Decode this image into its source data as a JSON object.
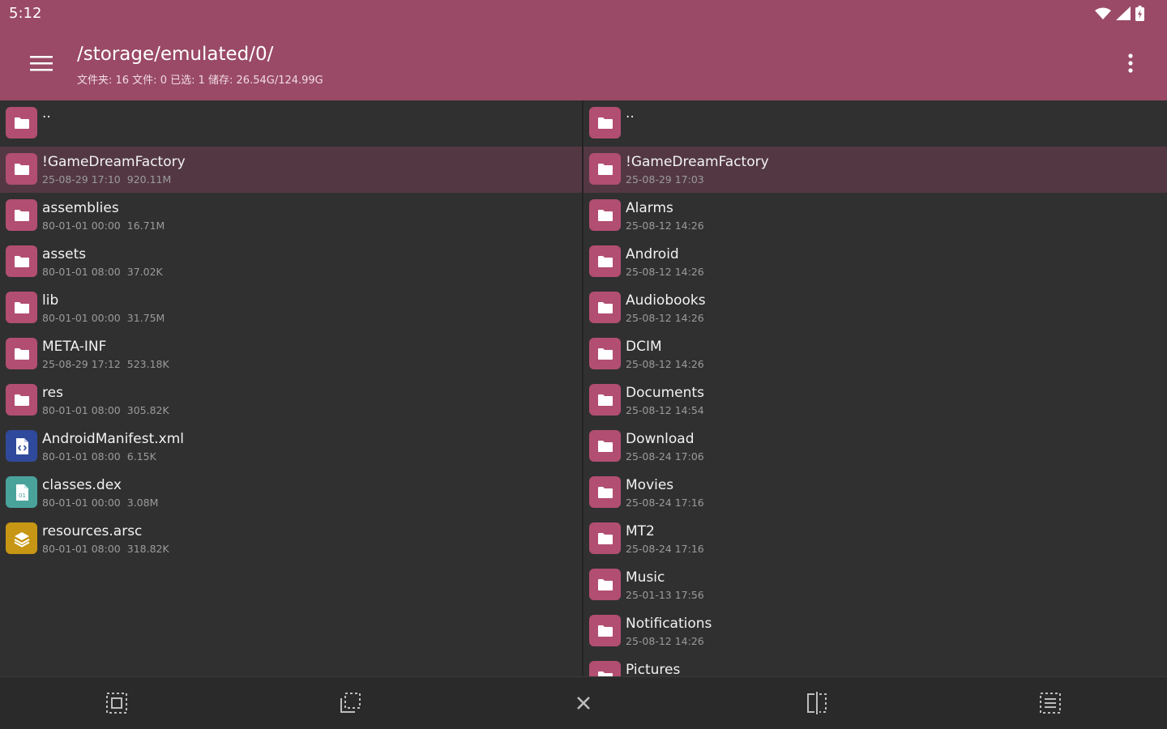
{
  "status": {
    "time": "5:12"
  },
  "toolbar": {
    "path": "/storage/emulated/0/",
    "info": "文件夹: 16  文件: 0  已选: 1  储存: 26.54G/124.99G"
  },
  "colors": {
    "accent": "#9a4a66",
    "folder": "#b24e72",
    "xml": "#2f4a9c",
    "dex": "#4aa39b",
    "arsc": "#c79614"
  },
  "left_panel": [
    {
      "name": "..",
      "date": "",
      "size": "",
      "icon": "folder-icon",
      "selected": false
    },
    {
      "name": "!GameDreamFactory",
      "date": "25-08-29 17:10",
      "size": "920.11M",
      "icon": "folder-icon",
      "selected": true
    },
    {
      "name": "assemblies",
      "date": "80-01-01 00:00",
      "size": "16.71M",
      "icon": "folder-icon",
      "selected": false
    },
    {
      "name": "assets",
      "date": "80-01-01 08:00",
      "size": "37.02K",
      "icon": "folder-icon",
      "selected": false
    },
    {
      "name": "lib",
      "date": "80-01-01 00:00",
      "size": "31.75M",
      "icon": "folder-icon",
      "selected": false
    },
    {
      "name": "META-INF",
      "date": "25-08-29 17:12",
      "size": "523.18K",
      "icon": "folder-icon",
      "selected": false
    },
    {
      "name": "res",
      "date": "80-01-01 08:00",
      "size": "305.82K",
      "icon": "folder-icon",
      "selected": false
    },
    {
      "name": "AndroidManifest.xml",
      "date": "80-01-01 08:00",
      "size": "6.15K",
      "icon": "xml-file-icon",
      "selected": false
    },
    {
      "name": "classes.dex",
      "date": "80-01-01 00:00",
      "size": "3.08M",
      "icon": "dex-file-icon",
      "selected": false
    },
    {
      "name": "resources.arsc",
      "date": "80-01-01 08:00",
      "size": "318.82K",
      "icon": "arsc-file-icon",
      "selected": false
    }
  ],
  "right_panel": [
    {
      "name": "..",
      "date": "",
      "size": "",
      "icon": "folder-icon",
      "selected": false
    },
    {
      "name": "!GameDreamFactory",
      "date": "25-08-29 17:03",
      "size": "",
      "icon": "folder-icon",
      "selected": true
    },
    {
      "name": "Alarms",
      "date": "25-08-12 14:26",
      "size": "",
      "icon": "folder-icon",
      "selected": false
    },
    {
      "name": "Android",
      "date": "25-08-12 14:26",
      "size": "",
      "icon": "folder-icon",
      "selected": false
    },
    {
      "name": "Audiobooks",
      "date": "25-08-12 14:26",
      "size": "",
      "icon": "folder-icon",
      "selected": false
    },
    {
      "name": "DCIM",
      "date": "25-08-12 14:26",
      "size": "",
      "icon": "folder-icon",
      "selected": false
    },
    {
      "name": "Documents",
      "date": "25-08-12 14:54",
      "size": "",
      "icon": "folder-icon",
      "selected": false
    },
    {
      "name": "Download",
      "date": "25-08-24 17:06",
      "size": "",
      "icon": "folder-icon",
      "selected": false
    },
    {
      "name": "Movies",
      "date": "25-08-24 17:16",
      "size": "",
      "icon": "folder-icon",
      "selected": false
    },
    {
      "name": "MT2",
      "date": "25-08-24 17:16",
      "size": "",
      "icon": "folder-icon",
      "selected": false
    },
    {
      "name": "Music",
      "date": "25-01-13 17:56",
      "size": "",
      "icon": "folder-icon",
      "selected": false
    },
    {
      "name": "Notifications",
      "date": "25-08-12 14:26",
      "size": "",
      "icon": "folder-icon",
      "selected": false
    },
    {
      "name": "Pictures",
      "date": "",
      "size": "",
      "icon": "folder-icon",
      "selected": false
    }
  ],
  "bottombar": {
    "buttons": [
      "select-all-icon",
      "select-range-icon",
      "close-icon",
      "mirror-panels-icon",
      "invert-selection-icon"
    ]
  }
}
